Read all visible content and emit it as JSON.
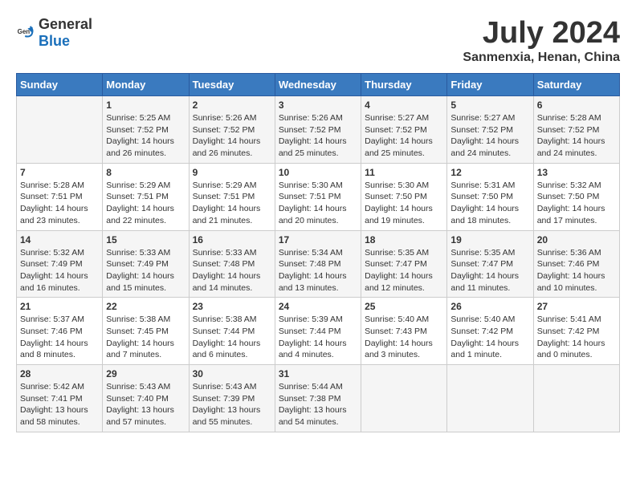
{
  "header": {
    "logo_general": "General",
    "logo_blue": "Blue",
    "title": "July 2024",
    "subtitle": "Sanmenxia, Henan, China"
  },
  "calendar": {
    "columns": [
      "Sunday",
      "Monday",
      "Tuesday",
      "Wednesday",
      "Thursday",
      "Friday",
      "Saturday"
    ],
    "weeks": [
      [
        {
          "day": "",
          "info": ""
        },
        {
          "day": "1",
          "info": "Sunrise: 5:25 AM\nSunset: 7:52 PM\nDaylight: 14 hours\nand 26 minutes."
        },
        {
          "day": "2",
          "info": "Sunrise: 5:26 AM\nSunset: 7:52 PM\nDaylight: 14 hours\nand 26 minutes."
        },
        {
          "day": "3",
          "info": "Sunrise: 5:26 AM\nSunset: 7:52 PM\nDaylight: 14 hours\nand 25 minutes."
        },
        {
          "day": "4",
          "info": "Sunrise: 5:27 AM\nSunset: 7:52 PM\nDaylight: 14 hours\nand 25 minutes."
        },
        {
          "day": "5",
          "info": "Sunrise: 5:27 AM\nSunset: 7:52 PM\nDaylight: 14 hours\nand 24 minutes."
        },
        {
          "day": "6",
          "info": "Sunrise: 5:28 AM\nSunset: 7:52 PM\nDaylight: 14 hours\nand 24 minutes."
        }
      ],
      [
        {
          "day": "7",
          "info": "Sunrise: 5:28 AM\nSunset: 7:51 PM\nDaylight: 14 hours\nand 23 minutes."
        },
        {
          "day": "8",
          "info": "Sunrise: 5:29 AM\nSunset: 7:51 PM\nDaylight: 14 hours\nand 22 minutes."
        },
        {
          "day": "9",
          "info": "Sunrise: 5:29 AM\nSunset: 7:51 PM\nDaylight: 14 hours\nand 21 minutes."
        },
        {
          "day": "10",
          "info": "Sunrise: 5:30 AM\nSunset: 7:51 PM\nDaylight: 14 hours\nand 20 minutes."
        },
        {
          "day": "11",
          "info": "Sunrise: 5:30 AM\nSunset: 7:50 PM\nDaylight: 14 hours\nand 19 minutes."
        },
        {
          "day": "12",
          "info": "Sunrise: 5:31 AM\nSunset: 7:50 PM\nDaylight: 14 hours\nand 18 minutes."
        },
        {
          "day": "13",
          "info": "Sunrise: 5:32 AM\nSunset: 7:50 PM\nDaylight: 14 hours\nand 17 minutes."
        }
      ],
      [
        {
          "day": "14",
          "info": "Sunrise: 5:32 AM\nSunset: 7:49 PM\nDaylight: 14 hours\nand 16 minutes."
        },
        {
          "day": "15",
          "info": "Sunrise: 5:33 AM\nSunset: 7:49 PM\nDaylight: 14 hours\nand 15 minutes."
        },
        {
          "day": "16",
          "info": "Sunrise: 5:33 AM\nSunset: 7:48 PM\nDaylight: 14 hours\nand 14 minutes."
        },
        {
          "day": "17",
          "info": "Sunrise: 5:34 AM\nSunset: 7:48 PM\nDaylight: 14 hours\nand 13 minutes."
        },
        {
          "day": "18",
          "info": "Sunrise: 5:35 AM\nSunset: 7:47 PM\nDaylight: 14 hours\nand 12 minutes."
        },
        {
          "day": "19",
          "info": "Sunrise: 5:35 AM\nSunset: 7:47 PM\nDaylight: 14 hours\nand 11 minutes."
        },
        {
          "day": "20",
          "info": "Sunrise: 5:36 AM\nSunset: 7:46 PM\nDaylight: 14 hours\nand 10 minutes."
        }
      ],
      [
        {
          "day": "21",
          "info": "Sunrise: 5:37 AM\nSunset: 7:46 PM\nDaylight: 14 hours\nand 8 minutes."
        },
        {
          "day": "22",
          "info": "Sunrise: 5:38 AM\nSunset: 7:45 PM\nDaylight: 14 hours\nand 7 minutes."
        },
        {
          "day": "23",
          "info": "Sunrise: 5:38 AM\nSunset: 7:44 PM\nDaylight: 14 hours\nand 6 minutes."
        },
        {
          "day": "24",
          "info": "Sunrise: 5:39 AM\nSunset: 7:44 PM\nDaylight: 14 hours\nand 4 minutes."
        },
        {
          "day": "25",
          "info": "Sunrise: 5:40 AM\nSunset: 7:43 PM\nDaylight: 14 hours\nand 3 minutes."
        },
        {
          "day": "26",
          "info": "Sunrise: 5:40 AM\nSunset: 7:42 PM\nDaylight: 14 hours\nand 1 minute."
        },
        {
          "day": "27",
          "info": "Sunrise: 5:41 AM\nSunset: 7:42 PM\nDaylight: 14 hours\nand 0 minutes."
        }
      ],
      [
        {
          "day": "28",
          "info": "Sunrise: 5:42 AM\nSunset: 7:41 PM\nDaylight: 13 hours\nand 58 minutes."
        },
        {
          "day": "29",
          "info": "Sunrise: 5:43 AM\nSunset: 7:40 PM\nDaylight: 13 hours\nand 57 minutes."
        },
        {
          "day": "30",
          "info": "Sunrise: 5:43 AM\nSunset: 7:39 PM\nDaylight: 13 hours\nand 55 minutes."
        },
        {
          "day": "31",
          "info": "Sunrise: 5:44 AM\nSunset: 7:38 PM\nDaylight: 13 hours\nand 54 minutes."
        },
        {
          "day": "",
          "info": ""
        },
        {
          "day": "",
          "info": ""
        },
        {
          "day": "",
          "info": ""
        }
      ]
    ]
  }
}
